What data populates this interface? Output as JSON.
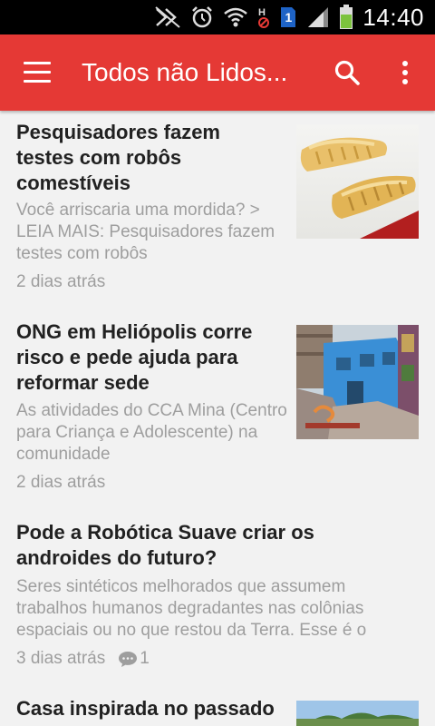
{
  "status": {
    "sim": "1",
    "time": "14:40"
  },
  "toolbar": {
    "title": "Todos não Lidos..."
  },
  "articles": [
    {
      "headline": "Pesquisadores fazem testes com robôs comestíveis",
      "summary": "Você arriscaria uma mordida? > LEIA MAIS: Pesquisadores fazem testes com robôs",
      "age": "2 dias atrás"
    },
    {
      "headline": "ONG em Heliópolis corre risco e pede ajuda para reformar sede",
      "summary": "As atividades do CCA Mina (Centro para Criança e Adolescente) na comunidade",
      "age": "2 dias atrás"
    },
    {
      "headline": "Pode a Robótica Suave criar os androides do futuro?",
      "summary": "Seres sintéticos melhorados que assumem trabalhos humanos degradantes nas colônias espaciais ou no que restou da Terra. Esse é o",
      "age": "3 dias atrás",
      "comments": "1"
    },
    {
      "headline": "Casa inspirada no passado"
    }
  ]
}
